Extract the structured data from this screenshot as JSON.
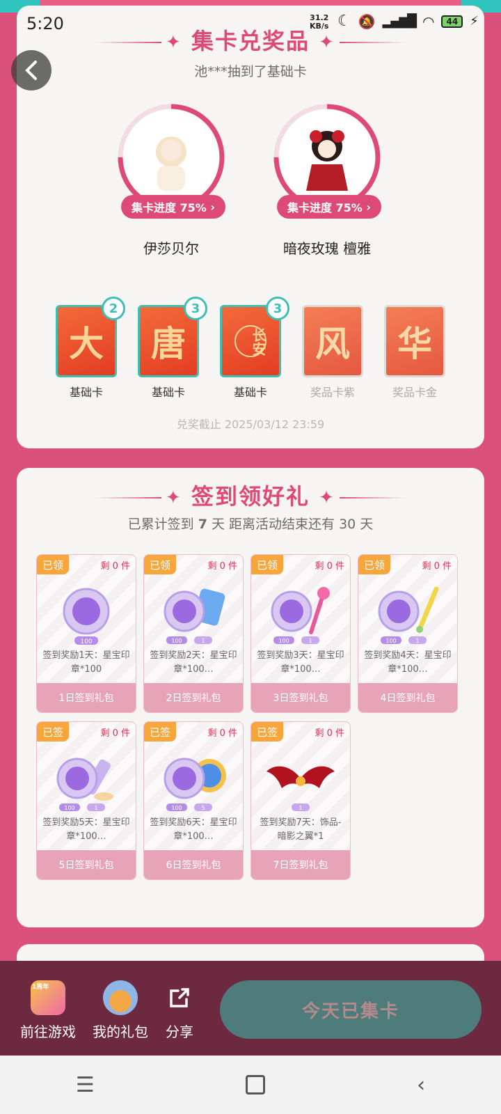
{
  "status": {
    "time": "5:20",
    "net_speed": "31.2",
    "net_unit": "KB/s",
    "battery": "44"
  },
  "exchange": {
    "title": "集卡兑奖品",
    "ticker": "池***抽到了基础卡",
    "characters": [
      {
        "name": "伊莎贝尔",
        "progress_label": "集卡进度 75%",
        "progress": 0.75
      },
      {
        "name": "暗夜玫瑰 檀雅",
        "progress_label": "集卡进度 75%",
        "progress": 0.75
      }
    ],
    "cards": [
      {
        "glyph": "大",
        "label": "基础卡",
        "count": "2",
        "owned": true
      },
      {
        "glyph": "唐",
        "label": "基础卡",
        "count": "3",
        "owned": true
      },
      {
        "glyph": "长安",
        "label": "基础卡",
        "count": "3",
        "owned": true
      },
      {
        "glyph": "风",
        "label": "奖品卡紫",
        "count": "",
        "owned": false
      },
      {
        "glyph": "华",
        "label": "奖品卡金",
        "count": "",
        "owned": false
      }
    ],
    "deadline": "兑奖截止 2025/03/12 23:59"
  },
  "signin": {
    "title": "签到领好礼",
    "summary_prefix": "已累计签到",
    "days_signed": "7",
    "summary_mid": "天  距离活动结束还有",
    "days_left": "30",
    "summary_suffix": "天",
    "gifts": [
      {
        "tag": "已领",
        "remain": "剩 0 件",
        "desc": "签到奖励1天：星宝印章*100",
        "foot": "1日签到礼包",
        "qty": [
          "100"
        ]
      },
      {
        "tag": "已领",
        "remain": "剩 0 件",
        "desc": "签到奖励2天：星宝印章*100…",
        "foot": "2日签到礼包",
        "qty": [
          "100",
          "1"
        ]
      },
      {
        "tag": "已领",
        "remain": "剩 0 件",
        "desc": "签到奖励3天：星宝印章*100…",
        "foot": "3日签到礼包",
        "qty": [
          "100",
          "1"
        ]
      },
      {
        "tag": "已领",
        "remain": "剩 0 件",
        "desc": "签到奖励4天：星宝印章*100…",
        "foot": "4日签到礼包",
        "qty": [
          "100",
          "1"
        ]
      },
      {
        "tag": "已签",
        "remain": "剩 0 件",
        "desc": "签到奖励5天：星宝印章*100…",
        "foot": "5日签到礼包",
        "qty": [
          "100",
          "1"
        ]
      },
      {
        "tag": "已签",
        "remain": "剩 0 件",
        "desc": "签到奖励6天：星宝印章*100…",
        "foot": "6日签到礼包",
        "qty": [
          "100",
          "5"
        ]
      },
      {
        "tag": "已签",
        "remain": "剩 0 件",
        "desc": "签到奖励7天：饰品-暗影之翼*1",
        "foot": "7日签到礼包",
        "qty": [
          "1"
        ]
      }
    ]
  },
  "bottom": {
    "go_game": "前往游戏",
    "my_gifts": "我的礼包",
    "share": "分享",
    "cta": "今天已集卡",
    "badge_year": "1周年"
  }
}
